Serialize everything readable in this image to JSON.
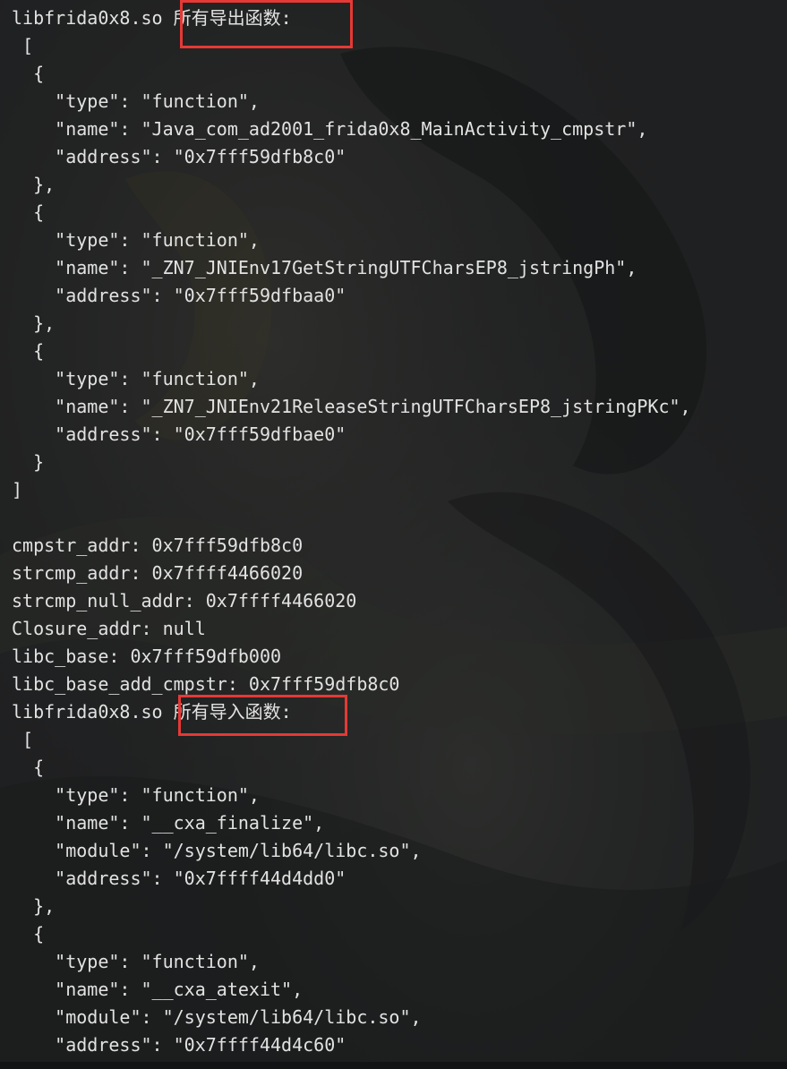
{
  "colors": {
    "text": "#e2e2e2",
    "background": "#1e1f20",
    "highlight_border": "#e53935"
  },
  "console": {
    "lines": [
      "libfrida0x8.so 所有导出函数:",
      " [",
      "  {",
      "    \"type\": \"function\",",
      "    \"name\": \"Java_com_ad2001_frida0x8_MainActivity_cmpstr\",",
      "    \"address\": \"0x7fff59dfb8c0\"",
      "  },",
      "  {",
      "    \"type\": \"function\",",
      "    \"name\": \"_ZN7_JNIEnv17GetStringUTFCharsEP8_jstringPh\",",
      "    \"address\": \"0x7fff59dfbaa0\"",
      "  },",
      "  {",
      "    \"type\": \"function\",",
      "    \"name\": \"_ZN7_JNIEnv21ReleaseStringUTFCharsEP8_jstringPKc\",",
      "    \"address\": \"0x7fff59dfbae0\"",
      "  }",
      "]",
      "",
      "cmpstr_addr: 0x7fff59dfb8c0",
      "strcmp_addr: 0x7ffff4466020",
      "strcmp_null_addr: 0x7ffff4466020",
      "Closure_addr: null",
      "libc_base: 0x7fff59dfb000",
      "libc_base_add_cmpstr: 0x7fff59dfb8c0",
      "libfrida0x8.so 所有导入函数:",
      " [",
      "  {",
      "    \"type\": \"function\",",
      "    \"name\": \"__cxa_finalize\",",
      "    \"module\": \"/system/lib64/libc.so\",",
      "    \"address\": \"0x7ffff44d4dd0\"",
      "  },",
      "  {",
      "    \"type\": \"function\",",
      "    \"name\": \"__cxa_atexit\",",
      "    \"module\": \"/system/lib64/libc.so\",",
      "    \"address\": \"0x7ffff44d4c60\""
    ]
  }
}
